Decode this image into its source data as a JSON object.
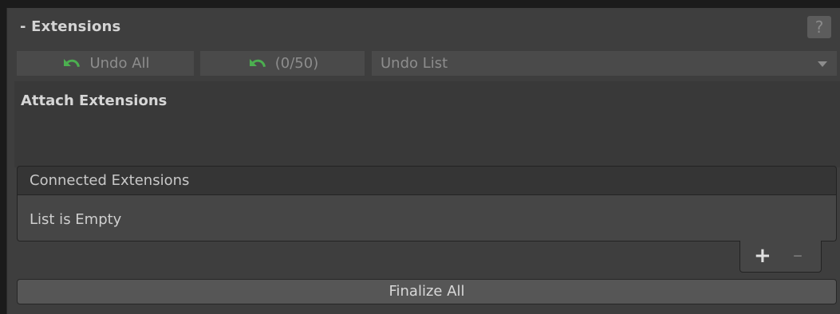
{
  "header": {
    "title": "- Extensions",
    "help_label": "?"
  },
  "toolbar": {
    "undo_all_label": "Undo All",
    "undo_count_label": "(0/50)",
    "undo_list_label": "Undo List",
    "icon": "undo-arrow-icon",
    "icon_color": "#4caf50"
  },
  "attach": {
    "title": "Attach Extensions"
  },
  "list": {
    "header": "Connected Extensions",
    "empty_text": "List is Empty",
    "add_label": "+",
    "remove_label": "–"
  },
  "finalize_label": "Finalize All"
}
